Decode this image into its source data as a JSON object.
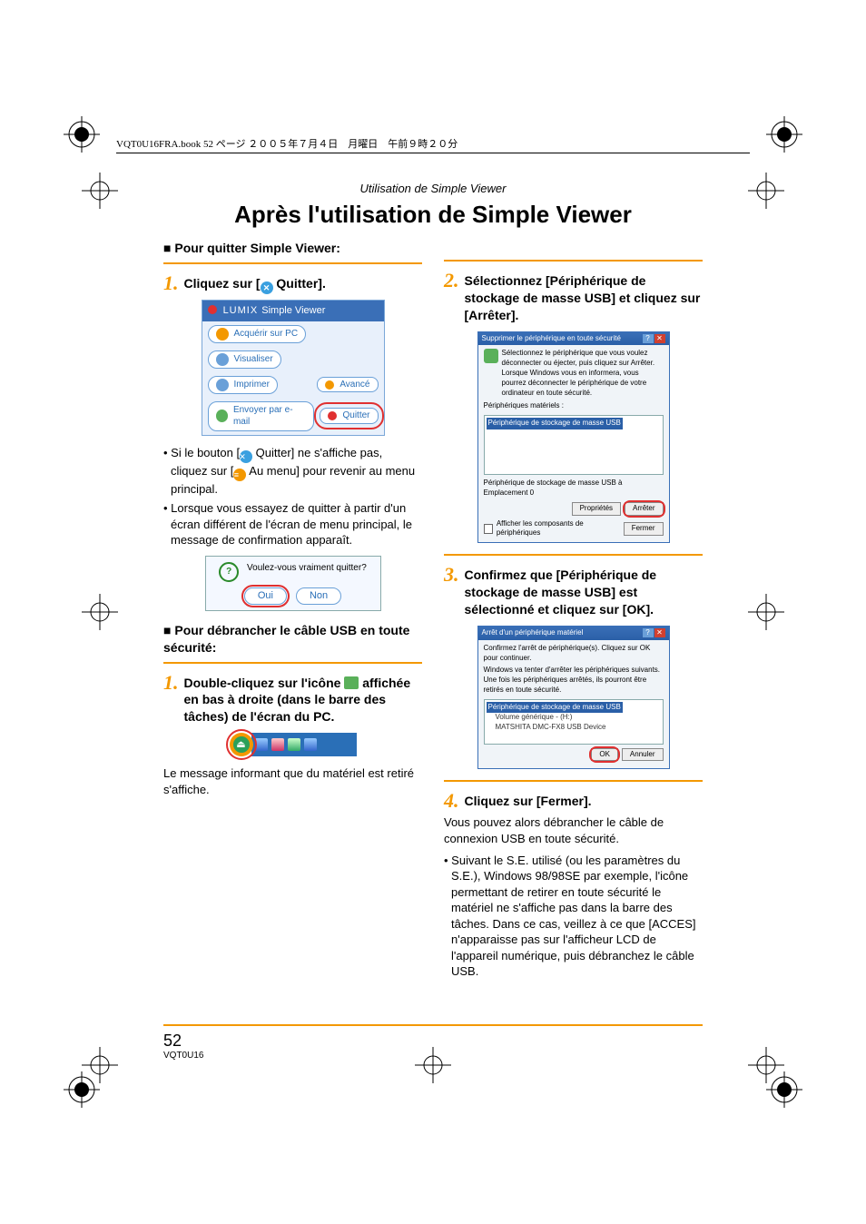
{
  "header_line": "VQT0U16FRA.book  52 ページ  ２００５年７月４日　月曜日　午前９時２０分",
  "running_head": "Utilisation de Simple Viewer",
  "title": "Après l'utilisation de Simple Viewer",
  "left": {
    "sub1_prefix": "■ ",
    "sub1": "Pour quitter Simple Viewer:",
    "step1_num": "1",
    "step1_pre": "Cliquez sur [",
    "step1_post": " Quitter].",
    "svpanel": {
      "brand_prefix": "LUMIX ",
      "brand": "Simple Viewer",
      "acquire": "Acquérir sur PC",
      "view": "Visualiser",
      "print": "Imprimer",
      "advanced": "Avancé",
      "email": "Envoyer par e-mail",
      "quit": "Quitter"
    },
    "note1_pre": "Si le bouton [",
    "note1_mid": " Quitter] ne s'affiche pas, cliquez sur [",
    "note1_post": " Au menu] pour revenir au menu principal.",
    "note2": "Lorsque vous essayez de quitter à partir d'un écran différent de l'écran de menu principal, le message de confirmation apparaît.",
    "confirm_msg": "Voulez-vous vraiment quitter?",
    "confirm_yes": "Oui",
    "confirm_no": "Non",
    "sub2_prefix": "■ ",
    "sub2": "Pour débrancher le câble USB en toute sécurité:",
    "step2_num": "1",
    "step2_a": "Double-cliquez sur l'icône ",
    "step2_b": " affichée en bas à droite (dans le barre des tâches) de l'écran du PC.",
    "after_step2": "Le message informant que du matériel est retiré s'affiche."
  },
  "right": {
    "step2_num": "2",
    "step2": "Sélectionnez [Périphérique de stockage de masse USB] et cliquez sur [Arrêter].",
    "dlg1": {
      "title": "Supprimer le périphérique en toute sécurité",
      "intro": "Sélectionnez le périphérique que vous voulez déconnecter ou éjecter, puis cliquez sur Arrêter. Lorsque Windows vous en informera, vous pourrez déconnecter le périphérique de votre ordinateur en toute sécurité.",
      "label_list": "Périphériques matériels :",
      "item": "Périphérique de stockage de masse USB",
      "desc": "Périphérique de stockage de masse USB à Emplacement 0",
      "btn_props": "Propriétés",
      "btn_stop": "Arrêter",
      "chk": "Afficher les composants de périphériques",
      "btn_close": "Fermer"
    },
    "step3_num": "3",
    "step3": "Confirmez que [Périphérique de stockage de masse USB] est sélectionné et cliquez sur [OK].",
    "dlg2": {
      "title": "Arrêt d'un périphérique matériel",
      "line1": "Confirmez l'arrêt de périphérique(s). Cliquez sur OK pour continuer.",
      "line2": "Windows va tenter d'arrêter les périphériques suivants. Une fois les périphériques arrêtés, ils pourront être retirés en toute sécurité.",
      "item1": "Périphérique de stockage de masse USB",
      "item2": "Volume générique - (H:)",
      "item3": "MATSHITA DMC-FX8 USB Device",
      "btn_ok": "OK",
      "btn_cancel": "Annuler"
    },
    "step4_num": "4",
    "step4": "Cliquez sur [Fermer].",
    "para1": "Vous pouvez alors débrancher le câble de connexion USB en toute sécurité.",
    "note": "Suivant le S.E. utilisé (ou les paramètres du S.E.), Windows 98/98SE par exemple, l'icône permettant de retirer en toute sécurité le matériel ne s'affiche pas dans la barre des tâches. Dans ce cas, veillez à ce que [ACCES] n'apparaisse pas sur l'afficheur LCD de l'appareil numérique, puis débranchez le câble USB."
  },
  "footer": {
    "page": "52",
    "doc": "VQT0U16"
  }
}
